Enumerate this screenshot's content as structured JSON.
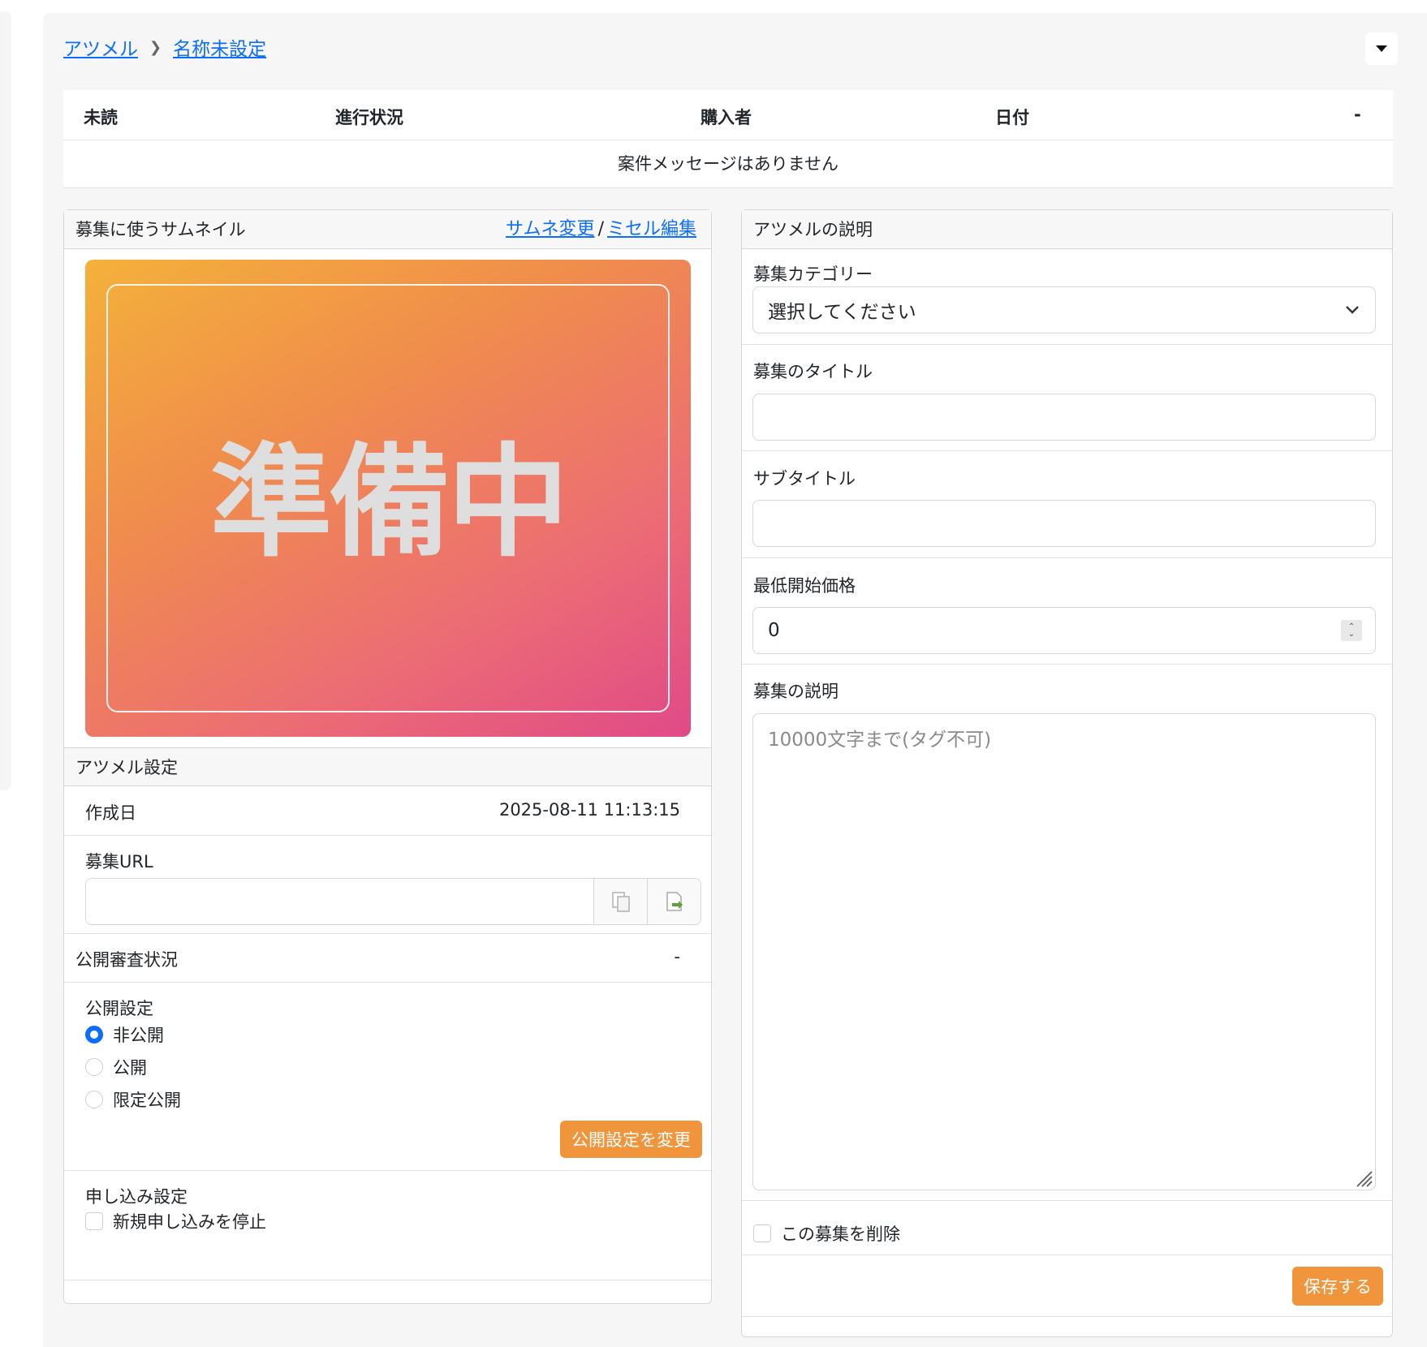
{
  "breadcrumb": {
    "home": "アツメル",
    "current": "名称未設定"
  },
  "messages": {
    "columns": [
      "未読",
      "進行状況",
      "購入者",
      "日付",
      "-"
    ],
    "empty_text": "案件メッセージはありません"
  },
  "thumbnail": {
    "header": "募集に使うサムネイル",
    "change_link": "サムネ変更",
    "separator": "/",
    "edit_link": "ミセル編集",
    "image_text": "準備中"
  },
  "settings": {
    "header": "アツメル設定",
    "created_label": "作成日",
    "created_value": "2025-08-11 11:13:15",
    "url_label": "募集URL",
    "url_value": "",
    "review_label": "公開審査状況",
    "review_value": "-",
    "visibility_label": "公開設定",
    "visibility_options": [
      "非公開",
      "公開",
      "限定公開"
    ],
    "visibility_selected": "非公開",
    "visibility_button": "公開設定を変更",
    "application_label": "申し込み設定",
    "stop_new_label": "新規申し込みを停止"
  },
  "description": {
    "header": "アツメルの説明",
    "category_label": "募集カテゴリー",
    "category_value": "選択してください",
    "title_label": "募集のタイトル",
    "title_value": "",
    "subtitle_label": "サブタイトル",
    "subtitle_value": "",
    "price_label": "最低開始価格",
    "price_value": "0",
    "desc_label": "募集の説明",
    "desc_placeholder": "10000文字まで(タグ不可)",
    "delete_label": "この募集を削除",
    "save_button": "保存する"
  },
  "colors": {
    "accent": "#f0953b",
    "link": "#0d6efd"
  },
  "icons": {
    "dropdown": "caret-down-icon",
    "copy": "copy-icon",
    "open": "open-link-icon",
    "select": "chevron-down-icon"
  }
}
